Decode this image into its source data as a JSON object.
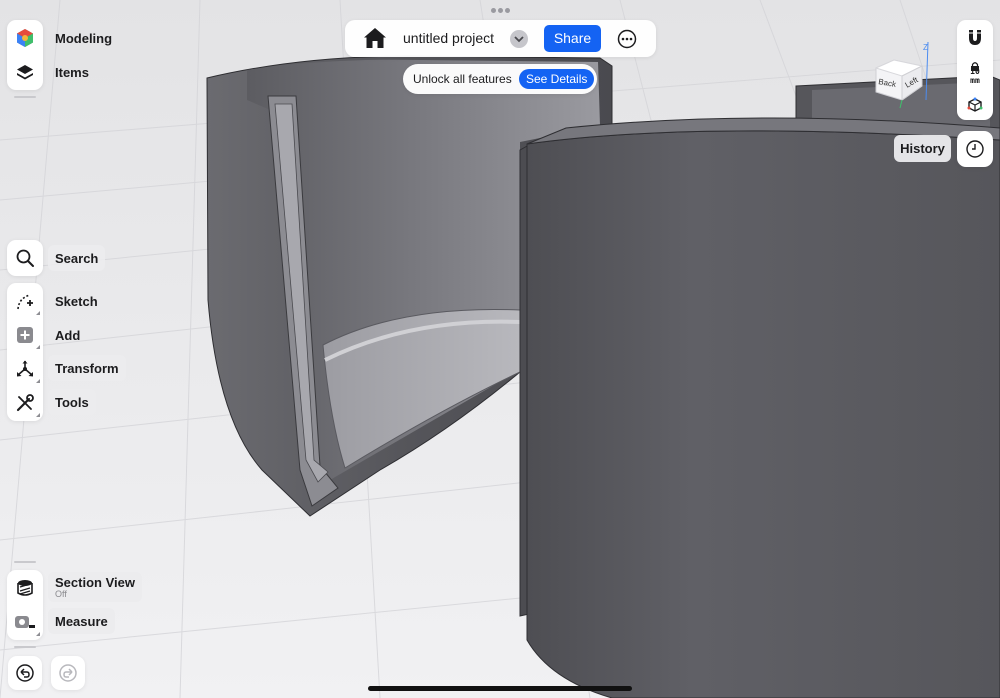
{
  "modes": {
    "modeling": "Modeling",
    "items": "Items"
  },
  "tools": {
    "search": "Search",
    "sketch": "Sketch",
    "add": "Add",
    "transform": "Transform",
    "tools": "Tools"
  },
  "bottom_tools": {
    "section_view": "Section View",
    "section_view_status": "Off",
    "measure": "Measure"
  },
  "topbar": {
    "project_title": "untitled project",
    "share_label": "Share"
  },
  "promo": {
    "text": "Unlock all features",
    "button": "See Details"
  },
  "view_cube": {
    "back": "Back",
    "left": "Left",
    "axis_z": "Z"
  },
  "snap": {
    "unit_value": "10",
    "unit": "mm"
  },
  "history": {
    "label": "History"
  },
  "colors": {
    "accent": "#1463f3",
    "model_face": "#5d5d62"
  }
}
